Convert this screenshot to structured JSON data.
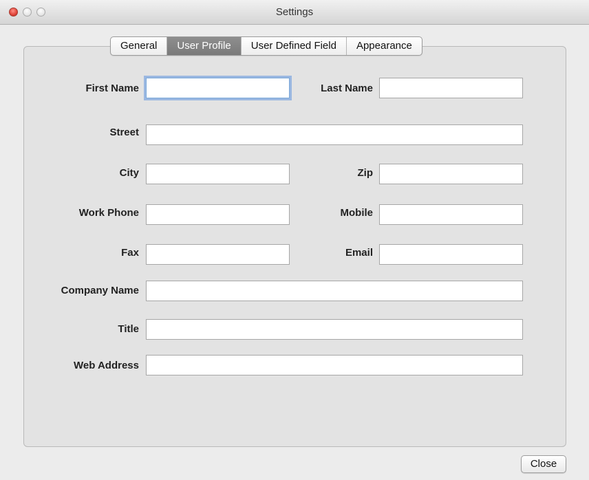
{
  "window": {
    "title": "Settings",
    "controls": [
      "close-button-icon",
      "minimize-button-icon",
      "zoom-button-icon"
    ]
  },
  "tabs": [
    {
      "label": "General",
      "active": false
    },
    {
      "label": "User Profile",
      "active": true
    },
    {
      "label": "User Defined Field",
      "active": false
    },
    {
      "label": "Appearance",
      "active": false
    }
  ],
  "form": {
    "first_name": {
      "label": "First Name",
      "value": ""
    },
    "last_name": {
      "label": "Last Name",
      "value": ""
    },
    "street": {
      "label": "Street",
      "value": ""
    },
    "city": {
      "label": "City",
      "value": ""
    },
    "zip": {
      "label": "Zip",
      "value": ""
    },
    "work_phone": {
      "label": "Work Phone",
      "value": ""
    },
    "mobile": {
      "label": "Mobile",
      "value": ""
    },
    "fax": {
      "label": "Fax",
      "value": ""
    },
    "email": {
      "label": "Email",
      "value": ""
    },
    "company_name": {
      "label": "Company Name",
      "value": ""
    },
    "title": {
      "label": "Title",
      "value": ""
    },
    "web_address": {
      "label": "Web Address",
      "value": ""
    }
  },
  "footer": {
    "close_label": "Close"
  }
}
